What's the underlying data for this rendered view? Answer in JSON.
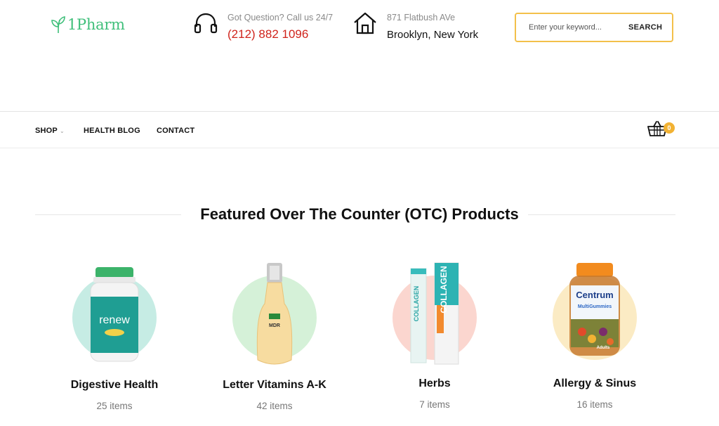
{
  "header": {
    "logo_text": "1Pharm",
    "contact": {
      "label": "Got Question? Call us 24/7",
      "phone": "(212) 882 1096"
    },
    "address": {
      "line1": "871 Flatbush AVe",
      "line2": "Brooklyn, New York"
    },
    "search": {
      "placeholder": "Enter your keyword...",
      "button_label": "SEARCH"
    }
  },
  "nav": {
    "items": [
      {
        "label": "SHOP",
        "has_dropdown": true
      },
      {
        "label": "HEALTH BLOG"
      },
      {
        "label": "CONTACT"
      }
    ],
    "cart_count": "0"
  },
  "featured": {
    "title": "Featured Over The Counter (OTC) Products",
    "products": [
      {
        "name": "Digestive Health",
        "count": "25 items",
        "product_label": "renew",
        "circle_color": "#c6ece4"
      },
      {
        "name": "Letter Vitamins A-K",
        "count": "42 items",
        "product_label": "MDR",
        "circle_color": "#d5f1d8"
      },
      {
        "name": "Herbs",
        "count": "7 items",
        "product_label": "COLLAGEN",
        "circle_color": "#fbd6cf"
      },
      {
        "name": "Allergy & Sinus",
        "count": "16 items",
        "product_label": "Centrum",
        "product_sublabel": "MultiGummies",
        "product_tag": "Adults",
        "circle_color": "#fbebc4"
      }
    ]
  },
  "colors": {
    "accent": "#f2b233",
    "phone": "#d0241c",
    "logo": "#3fbf7a"
  }
}
